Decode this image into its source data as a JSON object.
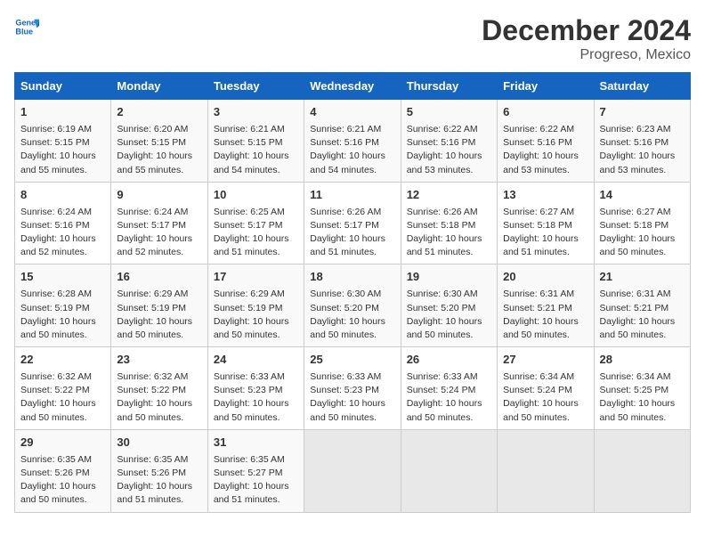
{
  "header": {
    "logo_line1": "General",
    "logo_line2": "Blue",
    "month_title": "December 2024",
    "location": "Progreso, Mexico"
  },
  "days_of_week": [
    "Sunday",
    "Monday",
    "Tuesday",
    "Wednesday",
    "Thursday",
    "Friday",
    "Saturday"
  ],
  "weeks": [
    [
      {
        "day": "1",
        "info": "Sunrise: 6:19 AM\nSunset: 5:15 PM\nDaylight: 10 hours\nand 55 minutes."
      },
      {
        "day": "2",
        "info": "Sunrise: 6:20 AM\nSunset: 5:15 PM\nDaylight: 10 hours\nand 55 minutes."
      },
      {
        "day": "3",
        "info": "Sunrise: 6:21 AM\nSunset: 5:15 PM\nDaylight: 10 hours\nand 54 minutes."
      },
      {
        "day": "4",
        "info": "Sunrise: 6:21 AM\nSunset: 5:16 PM\nDaylight: 10 hours\nand 54 minutes."
      },
      {
        "day": "5",
        "info": "Sunrise: 6:22 AM\nSunset: 5:16 PM\nDaylight: 10 hours\nand 53 minutes."
      },
      {
        "day": "6",
        "info": "Sunrise: 6:22 AM\nSunset: 5:16 PM\nDaylight: 10 hours\nand 53 minutes."
      },
      {
        "day": "7",
        "info": "Sunrise: 6:23 AM\nSunset: 5:16 PM\nDaylight: 10 hours\nand 53 minutes."
      }
    ],
    [
      {
        "day": "8",
        "info": "Sunrise: 6:24 AM\nSunset: 5:16 PM\nDaylight: 10 hours\nand 52 minutes."
      },
      {
        "day": "9",
        "info": "Sunrise: 6:24 AM\nSunset: 5:17 PM\nDaylight: 10 hours\nand 52 minutes."
      },
      {
        "day": "10",
        "info": "Sunrise: 6:25 AM\nSunset: 5:17 PM\nDaylight: 10 hours\nand 51 minutes."
      },
      {
        "day": "11",
        "info": "Sunrise: 6:26 AM\nSunset: 5:17 PM\nDaylight: 10 hours\nand 51 minutes."
      },
      {
        "day": "12",
        "info": "Sunrise: 6:26 AM\nSunset: 5:18 PM\nDaylight: 10 hours\nand 51 minutes."
      },
      {
        "day": "13",
        "info": "Sunrise: 6:27 AM\nSunset: 5:18 PM\nDaylight: 10 hours\nand 51 minutes."
      },
      {
        "day": "14",
        "info": "Sunrise: 6:27 AM\nSunset: 5:18 PM\nDaylight: 10 hours\nand 50 minutes."
      }
    ],
    [
      {
        "day": "15",
        "info": "Sunrise: 6:28 AM\nSunset: 5:19 PM\nDaylight: 10 hours\nand 50 minutes."
      },
      {
        "day": "16",
        "info": "Sunrise: 6:29 AM\nSunset: 5:19 PM\nDaylight: 10 hours\nand 50 minutes."
      },
      {
        "day": "17",
        "info": "Sunrise: 6:29 AM\nSunset: 5:19 PM\nDaylight: 10 hours\nand 50 minutes."
      },
      {
        "day": "18",
        "info": "Sunrise: 6:30 AM\nSunset: 5:20 PM\nDaylight: 10 hours\nand 50 minutes."
      },
      {
        "day": "19",
        "info": "Sunrise: 6:30 AM\nSunset: 5:20 PM\nDaylight: 10 hours\nand 50 minutes."
      },
      {
        "day": "20",
        "info": "Sunrise: 6:31 AM\nSunset: 5:21 PM\nDaylight: 10 hours\nand 50 minutes."
      },
      {
        "day": "21",
        "info": "Sunrise: 6:31 AM\nSunset: 5:21 PM\nDaylight: 10 hours\nand 50 minutes."
      }
    ],
    [
      {
        "day": "22",
        "info": "Sunrise: 6:32 AM\nSunset: 5:22 PM\nDaylight: 10 hours\nand 50 minutes."
      },
      {
        "day": "23",
        "info": "Sunrise: 6:32 AM\nSunset: 5:22 PM\nDaylight: 10 hours\nand 50 minutes."
      },
      {
        "day": "24",
        "info": "Sunrise: 6:33 AM\nSunset: 5:23 PM\nDaylight: 10 hours\nand 50 minutes."
      },
      {
        "day": "25",
        "info": "Sunrise: 6:33 AM\nSunset: 5:23 PM\nDaylight: 10 hours\nand 50 minutes."
      },
      {
        "day": "26",
        "info": "Sunrise: 6:33 AM\nSunset: 5:24 PM\nDaylight: 10 hours\nand 50 minutes."
      },
      {
        "day": "27",
        "info": "Sunrise: 6:34 AM\nSunset: 5:24 PM\nDaylight: 10 hours\nand 50 minutes."
      },
      {
        "day": "28",
        "info": "Sunrise: 6:34 AM\nSunset: 5:25 PM\nDaylight: 10 hours\nand 50 minutes."
      }
    ],
    [
      {
        "day": "29",
        "info": "Sunrise: 6:35 AM\nSunset: 5:26 PM\nDaylight: 10 hours\nand 50 minutes."
      },
      {
        "day": "30",
        "info": "Sunrise: 6:35 AM\nSunset: 5:26 PM\nDaylight: 10 hours\nand 51 minutes."
      },
      {
        "day": "31",
        "info": "Sunrise: 6:35 AM\nSunset: 5:27 PM\nDaylight: 10 hours\nand 51 minutes."
      },
      {
        "day": "",
        "info": ""
      },
      {
        "day": "",
        "info": ""
      },
      {
        "day": "",
        "info": ""
      },
      {
        "day": "",
        "info": ""
      }
    ]
  ]
}
